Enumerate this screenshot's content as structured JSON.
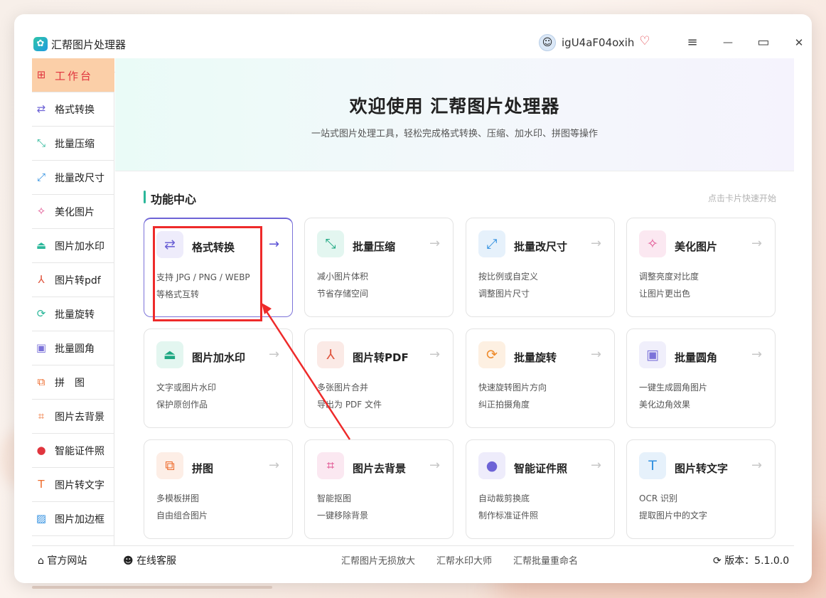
{
  "app": {
    "title": "汇帮图片处理器",
    "username": "igU4aF04oxih"
  },
  "window_controls": {
    "menu": "≡",
    "minimize": "—",
    "maximize": "▭",
    "close": "✕"
  },
  "sidebar": {
    "items": [
      {
        "label": "工作台",
        "icon": "grid-icon",
        "glyph": "⊞",
        "color": "#e0353e"
      },
      {
        "label": "格式转换",
        "icon": "format-convert-icon",
        "glyph": "⇄",
        "color": "#6d63d6"
      },
      {
        "label": "批量压缩",
        "icon": "compress-icon",
        "glyph": "⤡",
        "color": "#2bb79a"
      },
      {
        "label": "批量改尺寸",
        "icon": "resize-icon",
        "glyph": "⤢",
        "color": "#2f8fe0"
      },
      {
        "label": "美化图片",
        "icon": "beautify-icon",
        "glyph": "✧",
        "color": "#e04f8f"
      },
      {
        "label": "图片加水印",
        "icon": "watermark-icon",
        "glyph": "⏏",
        "color": "#2bb79a"
      },
      {
        "label": "图片转pdf",
        "icon": "pdf-icon",
        "glyph": "⅄",
        "color": "#e0553e"
      },
      {
        "label": "批量旋转",
        "icon": "rotate-icon",
        "glyph": "⟳",
        "color": "#2bb79a"
      },
      {
        "label": "批量圆角",
        "icon": "round-corner-icon",
        "glyph": "▣",
        "color": "#7c73d9"
      },
      {
        "label": "拼　图",
        "icon": "collage-icon",
        "glyph": "⧉",
        "color": "#ee6a2a"
      },
      {
        "label": "图片去背景",
        "icon": "remove-bg-icon",
        "glyph": "⌗",
        "color": "#ee6a2a"
      },
      {
        "label": "智能证件照",
        "icon": "id-photo-icon",
        "glyph": "●",
        "color": "#e0353e"
      },
      {
        "label": "图片转文字",
        "icon": "ocr-icon",
        "glyph": "T",
        "color": "#ee6a2a"
      },
      {
        "label": "图片加边框",
        "icon": "border-icon",
        "glyph": "▨",
        "color": "#2f8fe0"
      }
    ]
  },
  "hero": {
    "title": "欢迎使用 汇帮图片处理器",
    "subtitle": "一站式图片处理工具，轻松完成格式转换、压缩、加水印、拼图等操作"
  },
  "section": {
    "title": "功能中心",
    "hint": "点击卡片快速开始"
  },
  "cards": [
    {
      "title": "格式转换",
      "line1": "支持 JPG / PNG / WEBP",
      "line2": "等格式互转",
      "icon": "format-convert-icon",
      "glyph": "⇄",
      "color": "#6d63d6",
      "bg": "#eeecfb"
    },
    {
      "title": "批量压缩",
      "line1": "减小图片体积",
      "line2": "节省存储空间",
      "icon": "compress-icon",
      "glyph": "⤡",
      "color": "#1fa882",
      "bg": "#e3f6f0"
    },
    {
      "title": "批量改尺寸",
      "line1": "按比例或自定义",
      "line2": "调整图片尺寸",
      "icon": "resize-icon",
      "glyph": "⤢",
      "color": "#2f8fe0",
      "bg": "#e6f1fb"
    },
    {
      "title": "美化图片",
      "line1": "调整亮度对比度",
      "line2": "让图片更出色",
      "icon": "beautify-icon",
      "glyph": "✧",
      "color": "#e04f8f",
      "bg": "#fbe8f1"
    },
    {
      "title": "图片加水印",
      "line1": "文字或图片水印",
      "line2": "保护原创作品",
      "icon": "watermark-icon",
      "glyph": "⏏",
      "color": "#1fa882",
      "bg": "#e3f6f0"
    },
    {
      "title": "图片转PDF",
      "line1": "多张图片合并",
      "line2": "导出为 PDF 文件",
      "icon": "pdf-icon",
      "glyph": "⅄",
      "color": "#e0553e",
      "bg": "#fbeae6"
    },
    {
      "title": "批量旋转",
      "line1": "快速旋转图片方向",
      "line2": "纠正拍摄角度",
      "icon": "rotate-icon",
      "glyph": "⟳",
      "color": "#ee8a2a",
      "bg": "#fdf0e2"
    },
    {
      "title": "批量圆角",
      "line1": "一键生成圆角图片",
      "line2": "美化边角效果",
      "icon": "round-corner-icon",
      "glyph": "▣",
      "color": "#7c73d9",
      "bg": "#f0effb"
    },
    {
      "title": "拼图",
      "line1": "多模板拼图",
      "line2": "自由组合图片",
      "icon": "collage-icon",
      "glyph": "⧉",
      "color": "#ee6a2a",
      "bg": "#fdeee6"
    },
    {
      "title": "图片去背景",
      "line1": "智能抠图",
      "line2": "一键移除背景",
      "icon": "remove-bg-icon",
      "glyph": "⌗",
      "color": "#e04f8f",
      "bg": "#fbe8f1"
    },
    {
      "title": "智能证件照",
      "line1": "自动裁剪换底",
      "line2": "制作标准证件照",
      "icon": "id-photo-icon",
      "glyph": "●",
      "color": "#6d63d6",
      "bg": "#eeecfb"
    },
    {
      "title": "图片转文字",
      "line1": "OCR 识别",
      "line2": "提取图片中的文字",
      "icon": "ocr-icon",
      "glyph": "T",
      "color": "#2f8fe0",
      "bg": "#e6f1fb"
    }
  ],
  "card_arrow": "→",
  "footer": {
    "website": "官方网站",
    "service": "在线客服",
    "links": [
      "汇帮图片无损放大",
      "汇帮水印大师",
      "汇帮批量重命名"
    ],
    "version": "版本：5.1.0.0"
  }
}
